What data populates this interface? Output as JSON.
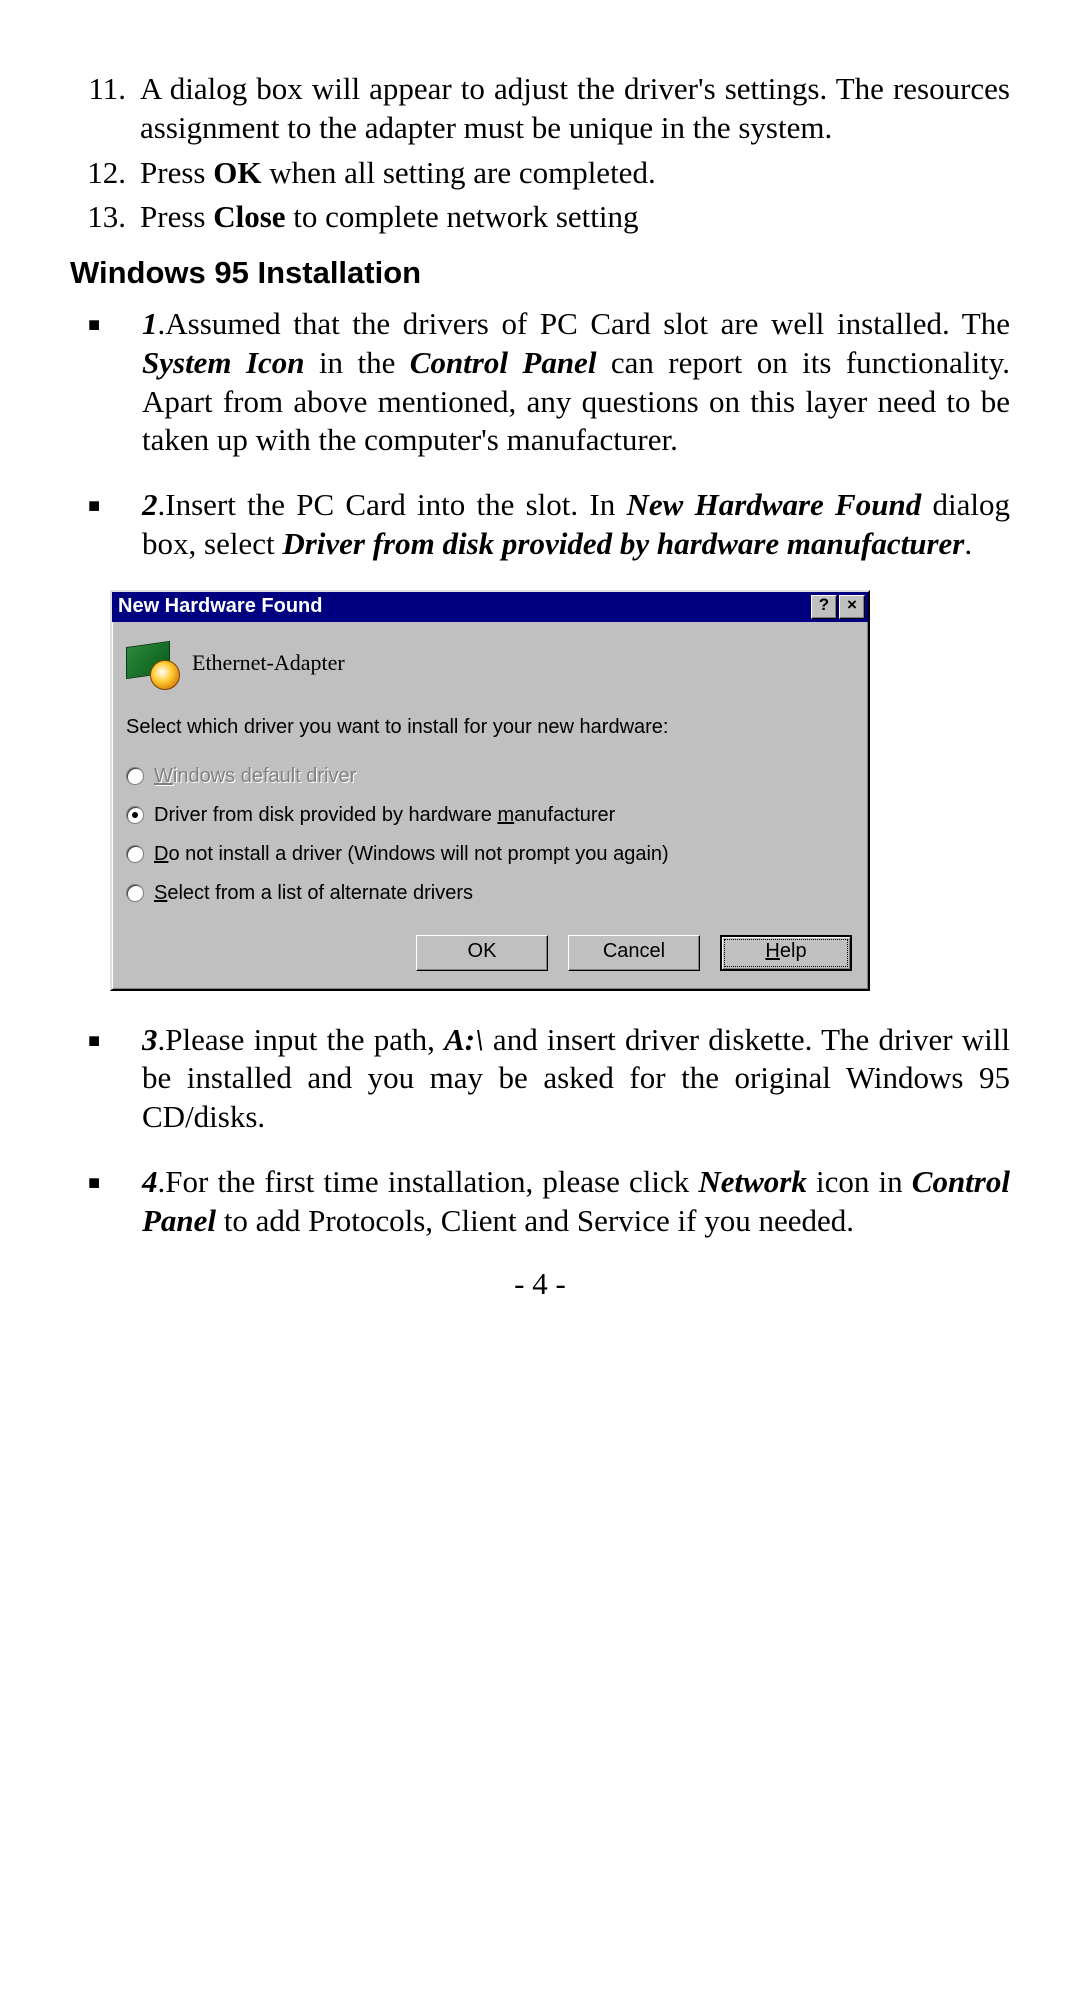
{
  "numbered": [
    {
      "n": "11.",
      "text": "A dialog box will appear to adjust the driver's settings. The resources assignment to the adapter must be unique in the system."
    },
    {
      "n": "12.",
      "pre": "Press ",
      "bold": "OK",
      "post": " when all setting are completed."
    },
    {
      "n": "13.",
      "pre": "Press  ",
      "bold": "Close",
      "post": " to complete network setting"
    }
  ],
  "heading": "Windows 95 Installation",
  "bullets": {
    "b1": {
      "num": "1",
      "t1": ".Assumed that the drivers of PC Card slot  are well installed. The ",
      "bi1": "System Icon",
      "t2": " in the ",
      "bi2": "Control Panel",
      "t3": " can report on its functionality. Apart from above mentioned, any questions on this layer need to be taken up with the computer's manufacturer."
    },
    "b2": {
      "num": "2",
      "t1": ".Insert the PC Card into the slot. In ",
      "bi1": "New Hardware Found",
      "t2": " dialog box, select ",
      "bi2": "Driver from disk provided by hardware manufacturer",
      "t3": "."
    },
    "b3": {
      "num": "3",
      "t1": ".Please input the path, ",
      "bi1": "A:\\",
      "t2": "  and insert driver diskette. The driver will be installed and you may be asked for the original Windows 95 CD/disks."
    },
    "b4": {
      "num": "4",
      "t1": ".For the first time installation, please click ",
      "bi1": "Network",
      "t2": " icon in ",
      "bi2": "Control Panel",
      "t3": " to add Protocols, Client and Service if you needed."
    }
  },
  "dialog": {
    "title": "New Hardware Found",
    "help_glyph": "?",
    "close_glyph": "×",
    "hw_name": "Ethernet-Adapter",
    "instruction": "Select which driver you want to install for your new hardware:",
    "options": {
      "o1": {
        "pre": "",
        "u": "W",
        "post": "indows default driver",
        "disabled": true,
        "selected": false
      },
      "o2": {
        "pre": "Driver from disk provided by hardware ",
        "u": "m",
        "post": "anufacturer",
        "disabled": false,
        "selected": true
      },
      "o3": {
        "pre": "",
        "u": "D",
        "post": "o not install a driver (Windows will not prompt you again)",
        "disabled": false,
        "selected": false
      },
      "o4": {
        "pre": "",
        "u": "S",
        "post": "elect from a list of alternate drivers",
        "disabled": false,
        "selected": false
      }
    },
    "buttons": {
      "ok": "OK",
      "cancel": "Cancel",
      "help_pre": "",
      "help_u": "H",
      "help_post": "elp"
    }
  },
  "page_number": "- 4 -"
}
